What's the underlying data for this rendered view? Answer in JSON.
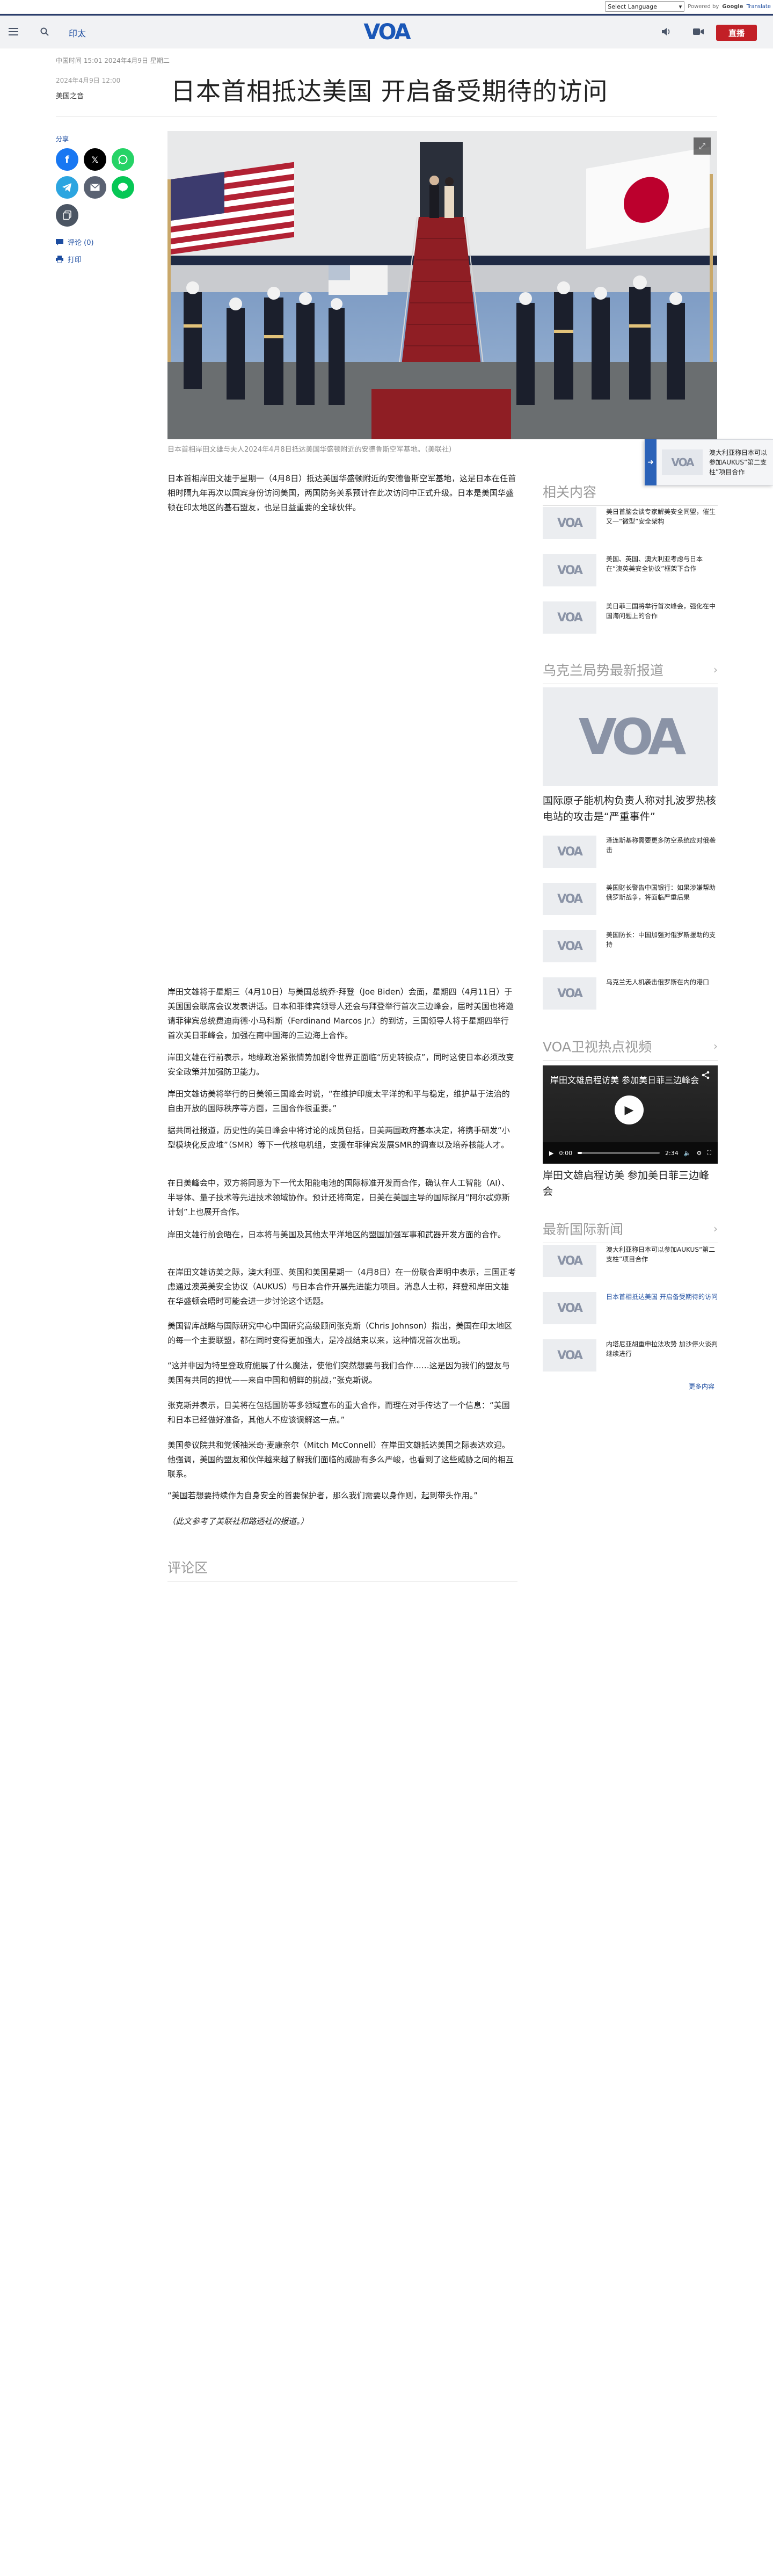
{
  "translate": {
    "select_label": "Select Language",
    "powered_by": "Powered by",
    "google": "Google",
    "translate": "Translate"
  },
  "nav": {
    "section": "印太",
    "logo": "VOA",
    "live": "直播",
    "icons": [
      "menu-icon",
      "search-icon",
      "speaker-icon",
      "video-camera-icon"
    ]
  },
  "article": {
    "meta_top": "中国时间 15:01 2024年4月9日 星期二",
    "date": "2024年4月9日 12:00",
    "author": "美国之音",
    "title": "日本首相抵达美国 开启备受期待的访问",
    "caption": "日本首相岸田文雄与夫人2024年4月8日抵达美国华盛顿附近的安德鲁斯空军基地。（美联社）",
    "paragraphs": [
      "日本首相岸田文雄于星期一（4月8日）抵达美国华盛顿附近的安德鲁斯空军基地，这是日本在任首相时隔九年再次以国宾身份访问美国，两国防务关系预计在此次访问中正式升级。日本是美国华盛顿在印太地区的基石盟友，也是日益重要的全球伙伴。",
      "岸田文雄将于星期三（4月10日）与美国总统乔·拜登（Joe Biden）会面，星期四（4月11日）于美国国会联席会议发表讲话。日本和菲律宾领导人还会与拜登举行首次三边峰会，届时美国也将邀请菲律宾总统费迪南德·小马科斯（Ferdinand Marcos Jr.）的到访，三国领导人将于星期四举行首次美日菲峰会，加强在南中国海的三边海上合作。",
      "岸田文雄在行前表示，地缘政治紧张情势加剧令世界正面临“历史转捩点”，同时这使日本必须改变安全政策并加强防卫能力。",
      "岸田文雄访美将举行的日美领三国峰会时说，“在维护印度太平洋的和平与稳定，维护基于法治的自由开放的国际秩序等方面，三国合作很重要。”",
      "据共同社报道，历史性的美日峰会中将讨论的成员包括，日美两国政府基本决定，将携手研发“小型模块化反应堆”（SMR）等下一代核电机组，支援在菲律宾发展SMR的调查以及培养核能人才。",
      "在日美峰会中，双方将同意为下一代太阳能电池的国际标准开发而合作，确认在人工智能（AI）、半导体、量子技术等先进技术领域协作。预计还将商定，日美在美国主导的国际探月“阿尔忒弥斯计划”上也展开合作。",
      "岸田文雄行前会晤在，日本将与美国及其他太平洋地区的盟国加强军事和武器开发方面的合作。",
      "在岸田文雄访美之际，澳大利亚、英国和美国星期一（4月8日）在一份联合声明中表示，三国正考虑通过澳英美安全协议（AUKUS）与日本合作开展先进能力项目。消息人士称，拜登和岸田文雄在华盛顿会晤时可能会进一步讨论这个话题。",
      "美国智库战略与国际研究中心中国研究高级顾问张克斯（Chris Johnson）指出，美国在印太地区的每一个主要联盟，都在同时变得更加强大，是冷战结束以来，这种情况首次出现。",
      "“这并非因为特里登政府施展了什么魔法，使他们突然想要与我们合作……这是因为我们的盟友与美国有共同的担忧——来自中国和朝鲜的挑战，”张克斯说。",
      "张克斯并表示，日美将在包括国防等多领域宣布的重大合作，而理在对手传达了一个信息：“美国和日本已经做好准备，其他人不应该误解这一点。”",
      "美国参议院共和党领袖米奇·麦康奈尔（Mitch McConnell）在岸田文雄抵达美国之际表达欢迎。他强调，美国的盟友和伙伴越来越了解我们面临的威胁有多么严峻，也看到了这些威胁之间的相互联系。",
      "“美国若想要持续作为自身安全的首要保护者，那么我们需要以身作则，起到带头作用。”",
      "（此文参考了美联社和路透社的报道。）"
    ],
    "side_links": {
      "comments": "评论 (0)",
      "print": "打印"
    },
    "comments_heading": "评论区"
  },
  "sidebar": {
    "related_heading": "相关内容",
    "related": [
      "美日首脑会谈专家解美安全同盟，催生又一“微型”安全架构",
      "美国、英国、澳大利亚考虑与日本在“澳英美安全协议”框架下合作",
      "美日菲三国将举行首次峰会，强化在中国海问题上的合作"
    ],
    "ukraine_heading": "乌克兰局势最新报道",
    "ukraine_main": "国际原子能机构负责人称对扎波罗热核电站的攻击是“严重事件”",
    "ukraine": [
      "泽连斯基称需要更多防空系统应对俄袭击",
      "美国财长警告中国银行：如果涉嫌帮助俄罗斯战争，将面临严重后果",
      "美国防长：中国加强对俄罗斯援助的支持",
      "乌克兰无人机袭击俄罗斯在内的港口"
    ],
    "video_heading": "VOA卫视热点视频",
    "video_title": "岸田文雄启程访美 参加美日菲三边峰会",
    "video_time": "0:00",
    "video_duration": "2:34",
    "video_progress": 0.05,
    "video_caption": "岸田文雄启程访美 参加美日菲三边峰会",
    "intl_heading": "最新国际新闻",
    "intl": [
      "澳大利亚称日本可以参加AUKUS“第二支柱”项目合作",
      "日本首相抵达美国 开启备受期待的访问",
      "内塔尼亚胡重申拉法攻势 加沙停火谈判继续进行"
    ],
    "more": "更多内容"
  },
  "float_tab": {
    "text": "澳大利亚称日本可以参加AUKUS“第二支柱”项目合作"
  },
  "colors": {
    "brand_blue": "#1a57b7",
    "live_red": "#c21f26",
    "nav_bg": "#f1f2f4"
  }
}
